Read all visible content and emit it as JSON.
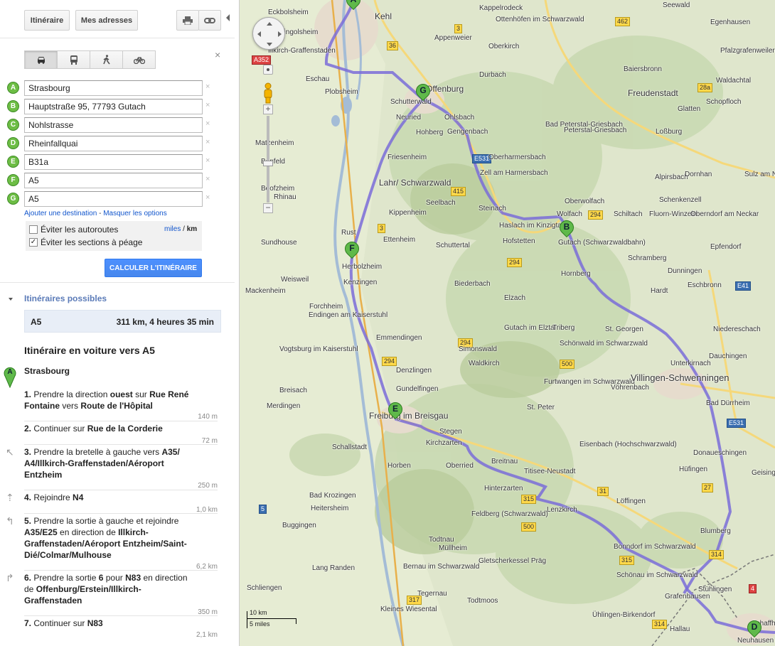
{
  "toolbar": {
    "itinerary_tab": "Itinéraire",
    "addresses_tab": "Mes adresses",
    "print_icon": "printer-icon",
    "link_icon": "link-icon"
  },
  "travel_modes": [
    "car-icon",
    "transit-icon",
    "walk-icon",
    "bike-icon"
  ],
  "waypoints": [
    {
      "letter": "A",
      "value": "Strasbourg"
    },
    {
      "letter": "B",
      "value": "Hauptstraße 95, 77793 Gutach"
    },
    {
      "letter": "C",
      "value": "Nohlstrasse"
    },
    {
      "letter": "D",
      "value": "Rheinfallquai"
    },
    {
      "letter": "E",
      "value": "B31a"
    },
    {
      "letter": "F",
      "value": "A5"
    },
    {
      "letter": "G",
      "value": "A5"
    }
  ],
  "links": {
    "add_destination": "Ajouter une destination",
    "separator": "-",
    "hide_options": "Masquer les options"
  },
  "options": {
    "avoid_highways": "Éviter les autoroutes",
    "avoid_highways_checked": false,
    "avoid_tolls": "Éviter les sections à péage",
    "avoid_tolls_checked": true,
    "units_miles": "miles",
    "units_sep": "/",
    "units_km": "km"
  },
  "calc_button": "CALCULER L'ITINÉRAIRE",
  "routes": {
    "heading": "Itinéraires possibles",
    "route_name": "A5",
    "route_summary": "311 km, 4 heures 35 min"
  },
  "directions": {
    "title": "Itinéraire en voiture vers A5",
    "start_letter": "A",
    "start": "Strasbourg",
    "steps": [
      {
        "html": "<b>1.</b> Prendre la direction <b>ouest</b> sur <b>Rue René Fontaine</b> vers <b>Route de l'Hôpital</b>",
        "dist": "140 m",
        "icon": ""
      },
      {
        "html": "<b>2.</b> Continuer sur <b>Rue de la Corderie</b>",
        "dist": "72 m",
        "icon": ""
      },
      {
        "html": "<b>3.</b> Prendre la bretelle à gauche vers <b>A35/ A4/Illkirch-Graffenstaden/Aéroport Entzheim</b>",
        "dist": "250 m",
        "icon": "ramp-left-icon"
      },
      {
        "html": "<b>4.</b> Rejoindre <b>N4</b>",
        "dist": "1,0 km",
        "icon": "merge-icon"
      },
      {
        "html": "<b>5.</b> Prendre la sortie à gauche et rejoindre <b>A35/E25</b> en direction de <b>Illkirch-Graffenstaden/Aéroport Entzheim/Saint-Dié/Colmar/Mulhouse</b>",
        "dist": "6,2 km",
        "icon": "exit-left-icon"
      },
      {
        "html": "<b>6.</b> Prendre la sortie <b>6</b> pour <b>N83</b> en direction de <b>Offenburg/Erstein/Illkirch-Graffenstaden</b>",
        "dist": "350 m",
        "icon": "exit-right-icon"
      },
      {
        "html": "<b>7.</b> Continuer sur <b>N83</b>",
        "dist": "2,1 km",
        "icon": ""
      }
    ]
  },
  "map": {
    "scale_km": "10 km",
    "scale_miles": "5 miles",
    "route_color": "#7a6cd8",
    "places": [
      "Eckbolsheim",
      "Kehl",
      "Kappelrodeck",
      "Ottenhöfen im Schwarzwald",
      "Seewald",
      "Egenhausen",
      "Lingolsheim",
      "Illkirch-Graffenstaden",
      "Appenweier",
      "Oberkirch",
      "Bad Peterstal-Griesbach",
      "Pfalzgrafenweiler",
      "Baiersbronn",
      "Freudenstadt",
      "Eschau",
      "Plobsheim",
      "Schutterwald",
      "Offenburg",
      "Durbach",
      "Neuried",
      "Ohlsbach",
      "Gengenbach",
      "Peterstal-Griesbach",
      "Loßburg",
      "Glatten",
      "Schopfloch",
      "Waldachtal",
      "Matzenheim",
      "Hohberg",
      "Friesenheim",
      "Oberharmersbach",
      "Zell am Harmersbach",
      "Alpirsbach",
      "Dornhan",
      "Sulz am Neckar",
      "Benfeld",
      "Lahr/ Schwarzwald",
      "Seelbach",
      "Oberwolfach",
      "Schenkenzell",
      "Boofzheim",
      "Rhinau",
      "Kippenheim",
      "Steinach",
      "Wolfach",
      "Schiltach",
      "Fluorn-Winzeln",
      "Oberndorf am Neckar",
      "Rust",
      "Ettenheim",
      "Haslach im Kinzigtal",
      "Gutach (Schwarzwaldbahn)",
      "Epfendorf",
      "Sundhouse",
      "Hofstetten",
      "Schuttertal",
      "Herbolzheim",
      "Hornberg",
      "Schramberg",
      "Kenzingen",
      "Biederbach",
      "Dunningen",
      "Hardt",
      "Mackenheim",
      "Weisweil",
      "Elzach",
      "Eschbronn",
      "Forchheim",
      "Endingen am Kaiserstuhl",
      "Gutach im Elztal",
      "Triberg",
      "St. Georgen",
      "Niedereschach",
      "Emmendingen",
      "Simonswald",
      "Vogtsburg im Kaiserstuhl",
      "Waldkirch",
      "Schönwald im Schwarzwald",
      "Unterkirnach",
      "Dauchingen",
      "Denzlingen",
      "Furtwangen im Schwarzwald",
      "Vöhrenbach",
      "Villingen-Schwenningen",
      "Breisach",
      "Gundelfingen",
      "Bad Dürrheim",
      "Merdingen",
      "Freiburg im Breisgau",
      "St. Peter",
      "Stegen",
      "Kirchzarten",
      "Eisenbach (Hochschwarzwald)",
      "Donaueschingen",
      "Schallstadt",
      "Breitnau",
      "Titisee-Neustadt",
      "Hüfingen",
      "Horben",
      "Oberried",
      "Geisingen",
      "Hinterzarten",
      "Bad Krozingen",
      "Löffingen",
      "Heitersheim",
      "Lenzkirch",
      "Buggingen",
      "Feldberg (Schwarzwald)",
      "Blumberg",
      "Todtnau",
      "Bonndorf im Schwarzwald",
      "Müllheim",
      "Gletscherkessel Präg",
      "Bernau im Schwarzwald",
      "Schönau im Schwarzwald",
      "Grafenhausen",
      "Stühlingen",
      "Lang Randen",
      "Schliengen",
      "Tegernau",
      "Todtmoos",
      "Ühlingen-Birkendorf",
      "Kleines Wiesental",
      "Hallau",
      "Schaffhausen",
      "Neuhausen am Rheinfall"
    ]
  }
}
